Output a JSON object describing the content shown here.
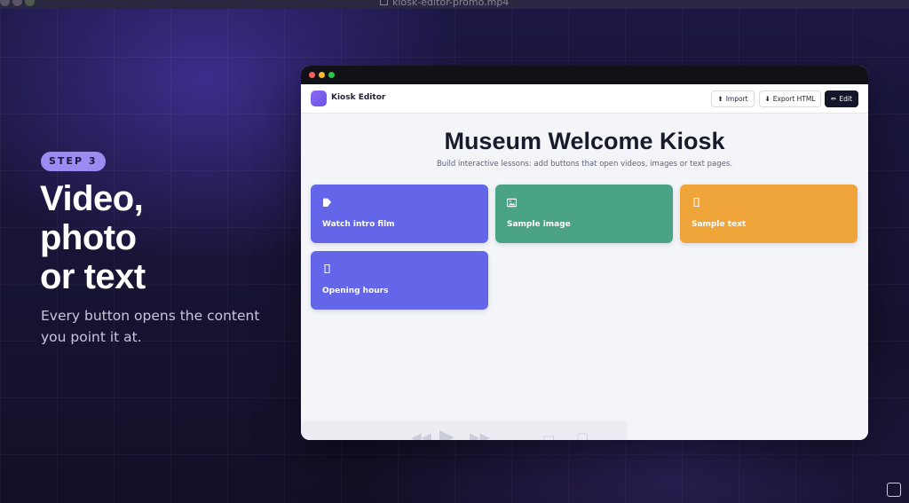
{
  "player": {
    "filename": "kiosk-editor-promo.mp4"
  },
  "slide": {
    "badge": "STEP 3",
    "headline_line1": "Video,",
    "headline_line2": "photo",
    "headline_line3": "or text",
    "subtext_line1": "Every button opens the content",
    "subtext_line2": "you point it at."
  },
  "app": {
    "name": "Kiosk Editor",
    "toolbar": {
      "import_label": "Import",
      "import_icon": "⬆",
      "export_label": "Export HTML",
      "export_icon": "⬇",
      "edit_label": "Edit",
      "edit_icon": "✏"
    },
    "kiosk": {
      "title": "Museum Welcome Kiosk",
      "subtitle": "Build interactive lessons: add buttons that open videos, images or text pages."
    },
    "cards": [
      {
        "label": "Watch intro film",
        "icon": "video-icon",
        "color": "#6366e8"
      },
      {
        "label": "Sample image",
        "icon": "image-icon",
        "color": "#4aa385"
      },
      {
        "label": "Sample text",
        "icon": "text-icon",
        "color": "#efa53a"
      },
      {
        "label": "Opening hours",
        "icon": "text-icon",
        "color": "#6366e8"
      }
    ]
  },
  "colors": {
    "accent": "#9b8cf2",
    "background": "#1c1844",
    "window_bg": "#f4f5f9"
  }
}
